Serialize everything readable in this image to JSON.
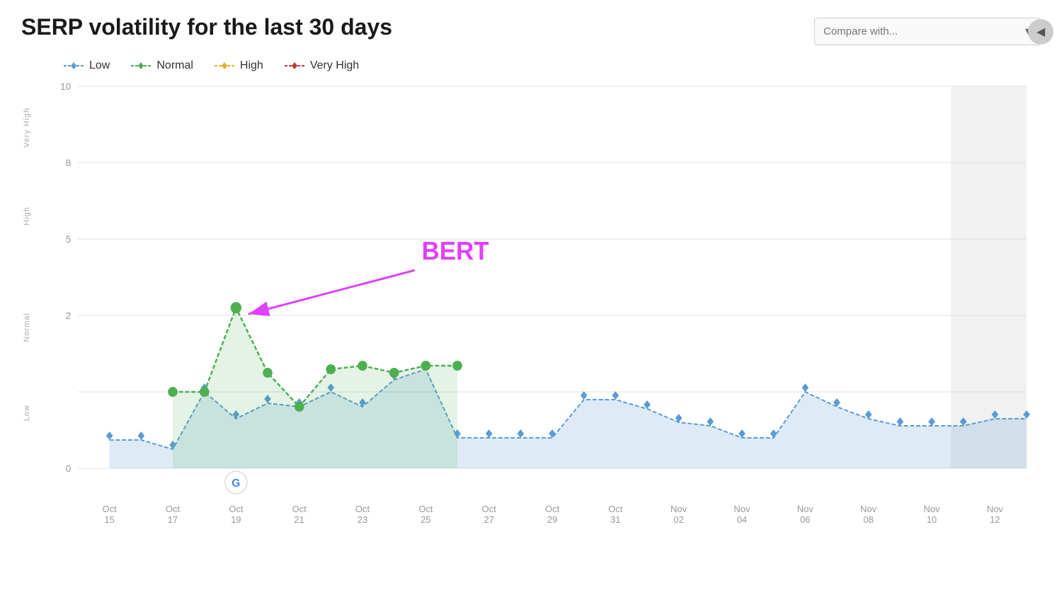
{
  "title": "SERP volatility for the last 30 days",
  "compare": {
    "placeholder": "Compare with...",
    "label": "Compare with ."
  },
  "legend": [
    {
      "id": "low",
      "label": "Low",
      "color": "#5b9bd5",
      "shape": "diamond"
    },
    {
      "id": "normal",
      "label": "Normal",
      "color": "#4caf50",
      "shape": "diamond"
    },
    {
      "id": "high",
      "label": "High",
      "color": "#f0a830",
      "shape": "diamond"
    },
    {
      "id": "very-high",
      "label": "Very High",
      "color": "#c0392b",
      "shape": "diamond"
    }
  ],
  "xLabels": [
    "Oct\n15",
    "Oct\n17",
    "Oct\n19",
    "Oct\n21",
    "Oct\n23",
    "Oct\n25",
    "Oct\n27",
    "Oct\n29",
    "Oct\n31",
    "Nov\n02",
    "Nov\n04",
    "Nov\n06",
    "Nov\n08",
    "Nov\n10",
    "Nov\n12"
  ],
  "yLabels": [
    "10",
    "8",
    "5",
    "2",
    "0"
  ],
  "bert_label": "BERT",
  "annotation": {
    "event": "BERT",
    "date": "Oct 19"
  }
}
